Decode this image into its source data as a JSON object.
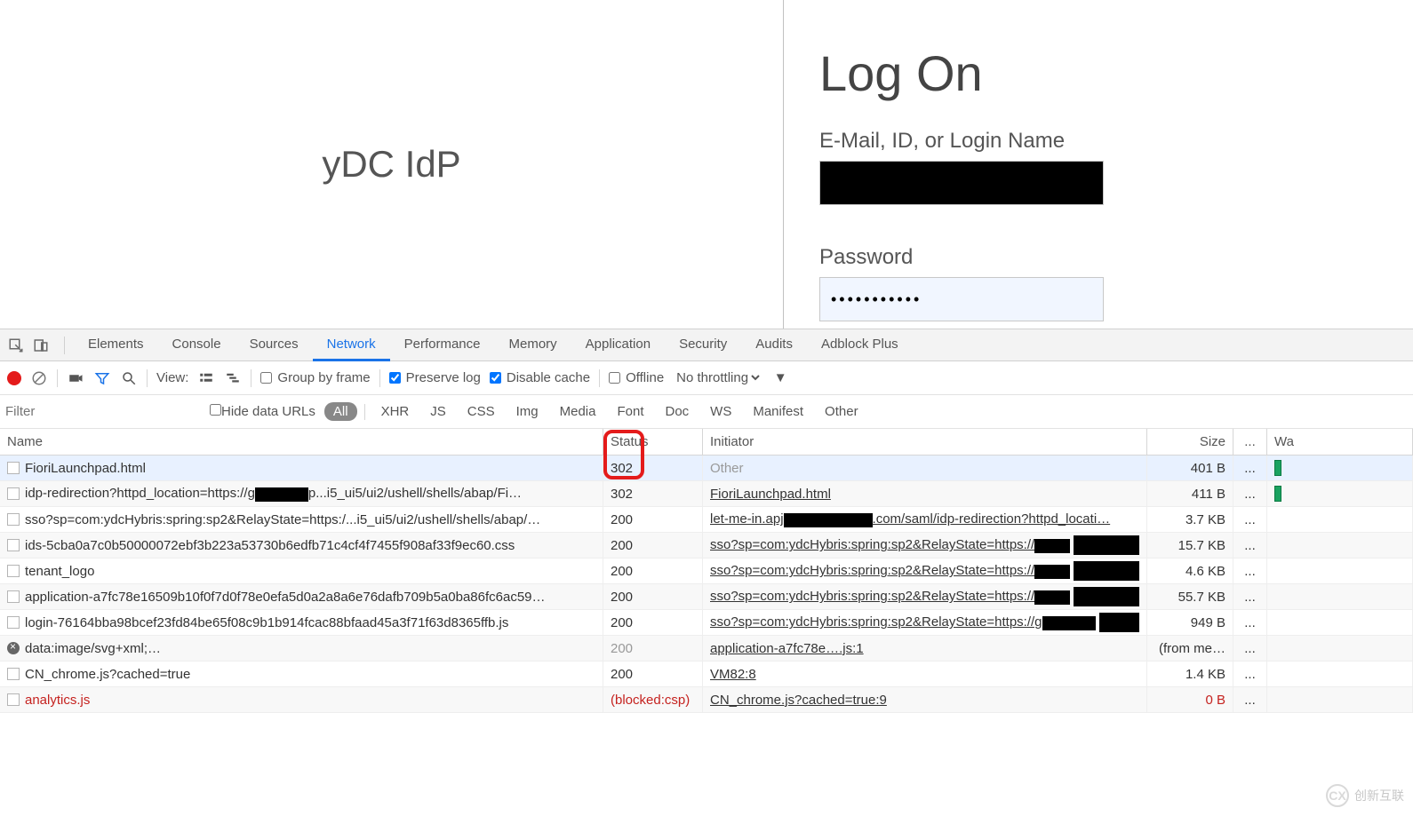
{
  "login": {
    "left_title": "yDC IdP",
    "heading": "Log On",
    "email_label": "E-Mail, ID, or Login Name",
    "password_label": "Password",
    "password_value": "•••••••••••"
  },
  "watermark": {
    "text": "创新互联",
    "logo_text": "CX"
  },
  "devtools": {
    "tabs": [
      "Elements",
      "Console",
      "Sources",
      "Network",
      "Performance",
      "Memory",
      "Application",
      "Security",
      "Audits",
      "Adblock Plus"
    ],
    "active_tab": "Network",
    "toolbar": {
      "view_label": "View:",
      "group_by_frame": "Group by frame",
      "preserve_log": "Preserve log",
      "disable_cache": "Disable cache",
      "offline": "Offline",
      "throttle": "No throttling"
    },
    "filter": {
      "placeholder": "Filter",
      "hide_urls": "Hide data URLs",
      "types": [
        "All",
        "XHR",
        "JS",
        "CSS",
        "Img",
        "Media",
        "Font",
        "Doc",
        "WS",
        "Manifest",
        "Other"
      ],
      "active_type": "All"
    },
    "columns": {
      "name": "Name",
      "status": "Status",
      "initiator": "Initiator",
      "size": "Size",
      "dots": "...",
      "wf": "Wa"
    },
    "rows": [
      {
        "name": "FioriLaunchpad.html",
        "status": "302",
        "status_hl": true,
        "initiator": "Other",
        "initiator_link": false,
        "initiator_gray": true,
        "size": "401 B",
        "dots": "...",
        "wf": true,
        "sel": true,
        "icon": "doc"
      },
      {
        "name": "idp-redirection?httpd_location=https://g██████p...i5_ui5/ui2/ushell/shells/abap/Fi…",
        "status": "302",
        "status_hl": true,
        "initiator": "FioriLaunchpad.html",
        "initiator_link": true,
        "size": "411 B",
        "dots": "...",
        "wf": true,
        "icon": "doc"
      },
      {
        "name": "sso?sp=com:ydcHybris:spring:sp2&RelayState=https:/...i5_ui5/ui2/ushell/shells/abap/…",
        "status": "200",
        "initiator": "let-me-in.apj██████████.com/saml/idp-redirection?httpd_locati…",
        "initiator_link": true,
        "size": "3.7 KB",
        "dots": "...",
        "icon": "doc"
      },
      {
        "name": "ids-5cba0a7c0b50000072ebf3b223a53730b6edfb71c4cf4f7455f908af33f9ec60.css",
        "status": "200",
        "initiator": "sso?sp=com:ydcHybris:spring:sp2&RelayState=https://████",
        "initiator_link": true,
        "size": "15.7 KB",
        "dots": "...",
        "icon": "doc",
        "mask": true
      },
      {
        "name": "tenant_logo",
        "status": "200",
        "initiator": "sso?sp=com:ydcHybris:spring:sp2&RelayState=https://████",
        "initiator_link": true,
        "size": "4.6 KB",
        "dots": "...",
        "icon": "doc",
        "mask": true
      },
      {
        "name": "application-a7fc78e16509b10f0f7d0f78e0efa5d0a2a8a6e76dafb709b5a0ba86fc6ac59…",
        "status": "200",
        "initiator": "sso?sp=com:ydcHybris:spring:sp2&RelayState=https://████",
        "initiator_link": true,
        "size": "55.7 KB",
        "dots": "...",
        "icon": "doc",
        "mask": true
      },
      {
        "name": "login-76164bba98bcef23fd84be65f08c9b1b914fcac88bfaad45a3f71f63d8365ffb.js",
        "status": "200",
        "initiator": "sso?sp=com:ydcHybris:spring:sp2&RelayState=https://g██████",
        "initiator_link": true,
        "size": "949 B",
        "dots": "...",
        "icon": "doc",
        "mask": true
      },
      {
        "name": "data:image/svg+xml;…",
        "status": "200",
        "status_gray": true,
        "initiator": "application-a7fc78e….js:1",
        "initiator_link": true,
        "size": "(from me…",
        "dots": "...",
        "icon": "block"
      },
      {
        "name": "CN_chrome.js?cached=true",
        "status": "200",
        "initiator": "VM82:8",
        "initiator_link": true,
        "size": "1.4 KB",
        "dots": "...",
        "icon": "doc"
      },
      {
        "name": "analytics.js",
        "status": "(blocked:csp)",
        "status_red": true,
        "name_red": true,
        "initiator": "CN_chrome.js?cached=true:9",
        "initiator_link": true,
        "initiator_red": true,
        "size": "0 B",
        "size_red": true,
        "dots": "...",
        "icon": "doc"
      }
    ]
  }
}
